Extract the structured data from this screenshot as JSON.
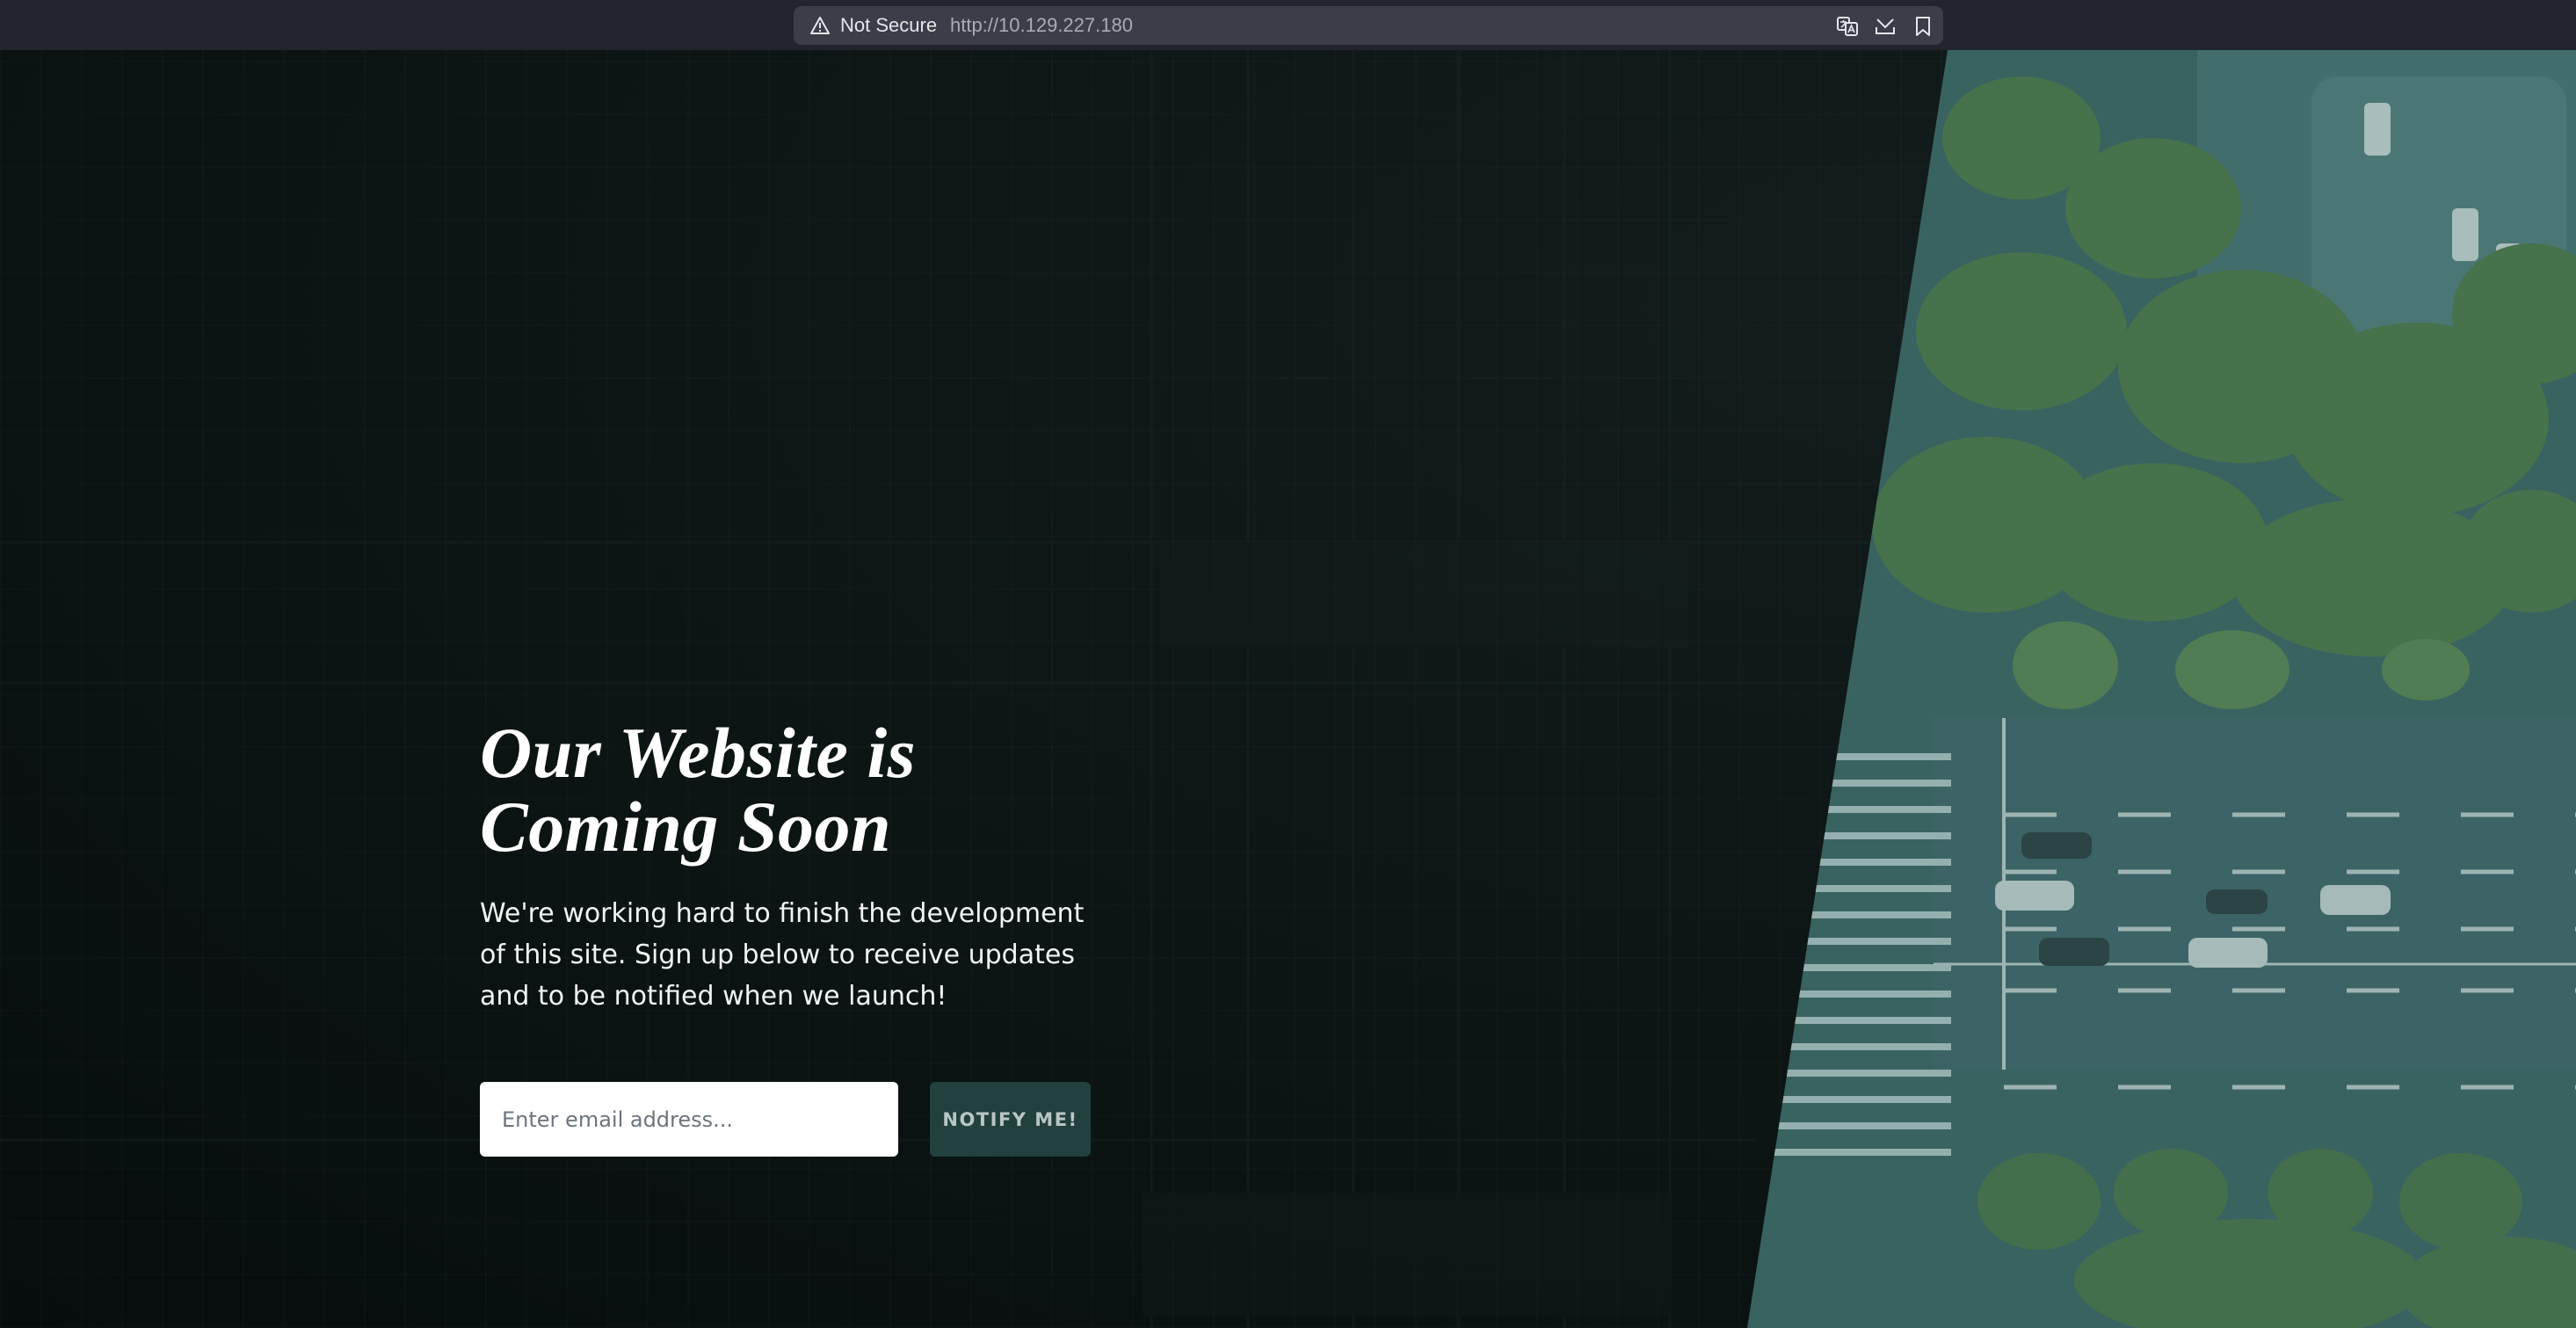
{
  "browser": {
    "security_label": "Not Secure",
    "url": "http://10.129.227.180",
    "icons": [
      "warning-icon",
      "translate-icon",
      "downloads-icon",
      "bookmark-icon"
    ]
  },
  "hero": {
    "title_line1": "Our Website is",
    "title_line2": "Coming Soon",
    "description": "We're working hard to finish the development of this site. Sign up below to receive updates and to be notified when we launch!"
  },
  "signup": {
    "email_placeholder": "Enter email address...",
    "button_label": "NOTIFY ME!"
  },
  "colors": {
    "background": "#0b1212",
    "button": "#22403e",
    "aerial_tint": "#3d6663"
  }
}
